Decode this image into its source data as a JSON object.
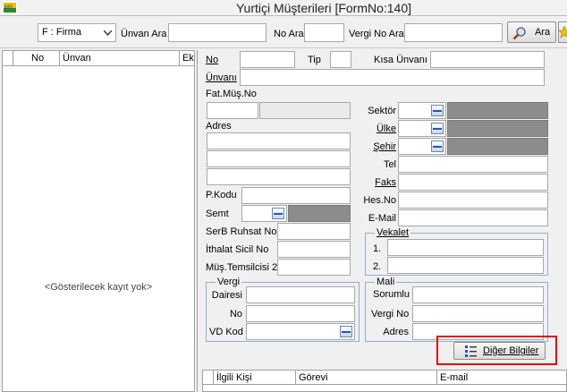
{
  "window": {
    "title": "Yurtiçi Müşterileri [FormNo:140]"
  },
  "toolbar": {
    "filter_select": "F : Firma",
    "unvan_ara_label": "Ünvan Ara",
    "unvan_ara_value": "",
    "no_ara_label": "No Ara",
    "no_ara_value": "",
    "vergi_no_ara_label": "Vergi No Ara",
    "vergi_no_ara_value": "",
    "search_button": "Ara"
  },
  "list": {
    "columns": [
      "",
      "No",
      "Ünvan",
      "Ek"
    ],
    "empty_message": "<Gösterilecek kayıt yok>"
  },
  "form": {
    "no_label": "No",
    "tip_label": "Tip",
    "kisa_unvani_label": "Kısa Ünvanı",
    "unvani_label": "Ünvanı",
    "fat_mus_no_label": "Fat.Müş.No",
    "adres_label": "Adres",
    "p_kodu_label": "P.Kodu",
    "semt_label": "Semt",
    "serb_ruhsat_no_label": "SerB Ruhsat No",
    "ithalat_sicil_no_label": "İthalat Sicil No",
    "mus_temsilcisi_2_label": "Müş.Temsilcisi 2",
    "sektor_label": "Sektör",
    "ulke_label": "Ülke",
    "sehir_label": "Şehir",
    "tel_label": "Tel",
    "faks_label": "Faks",
    "hes_no_label": "Hes.No",
    "e_mail_label": "E-Mail",
    "vekalet": {
      "title": "Vekalet",
      "row1": "1.",
      "row2": "2."
    },
    "vergi": {
      "title": "Vergi",
      "dairesi_label": "Dairesi",
      "no_label": "No",
      "vd_kod_label": "VD Kod"
    },
    "mali": {
      "title": "Mali",
      "sorumlu_label": "Sorumlu",
      "vergi_no_label": "Vergi No",
      "adres_label": "Adres"
    },
    "diger_bilgiler_button": "Diğer Bilgiler"
  },
  "contacts_grid": {
    "columns": [
      "",
      "İlgili Kişi",
      "Görevi",
      "E-mail"
    ]
  },
  "colors": {
    "highlight": "#e00000",
    "group_border": "#8fb0d0",
    "lookup_dark": "#8c8c8c"
  }
}
